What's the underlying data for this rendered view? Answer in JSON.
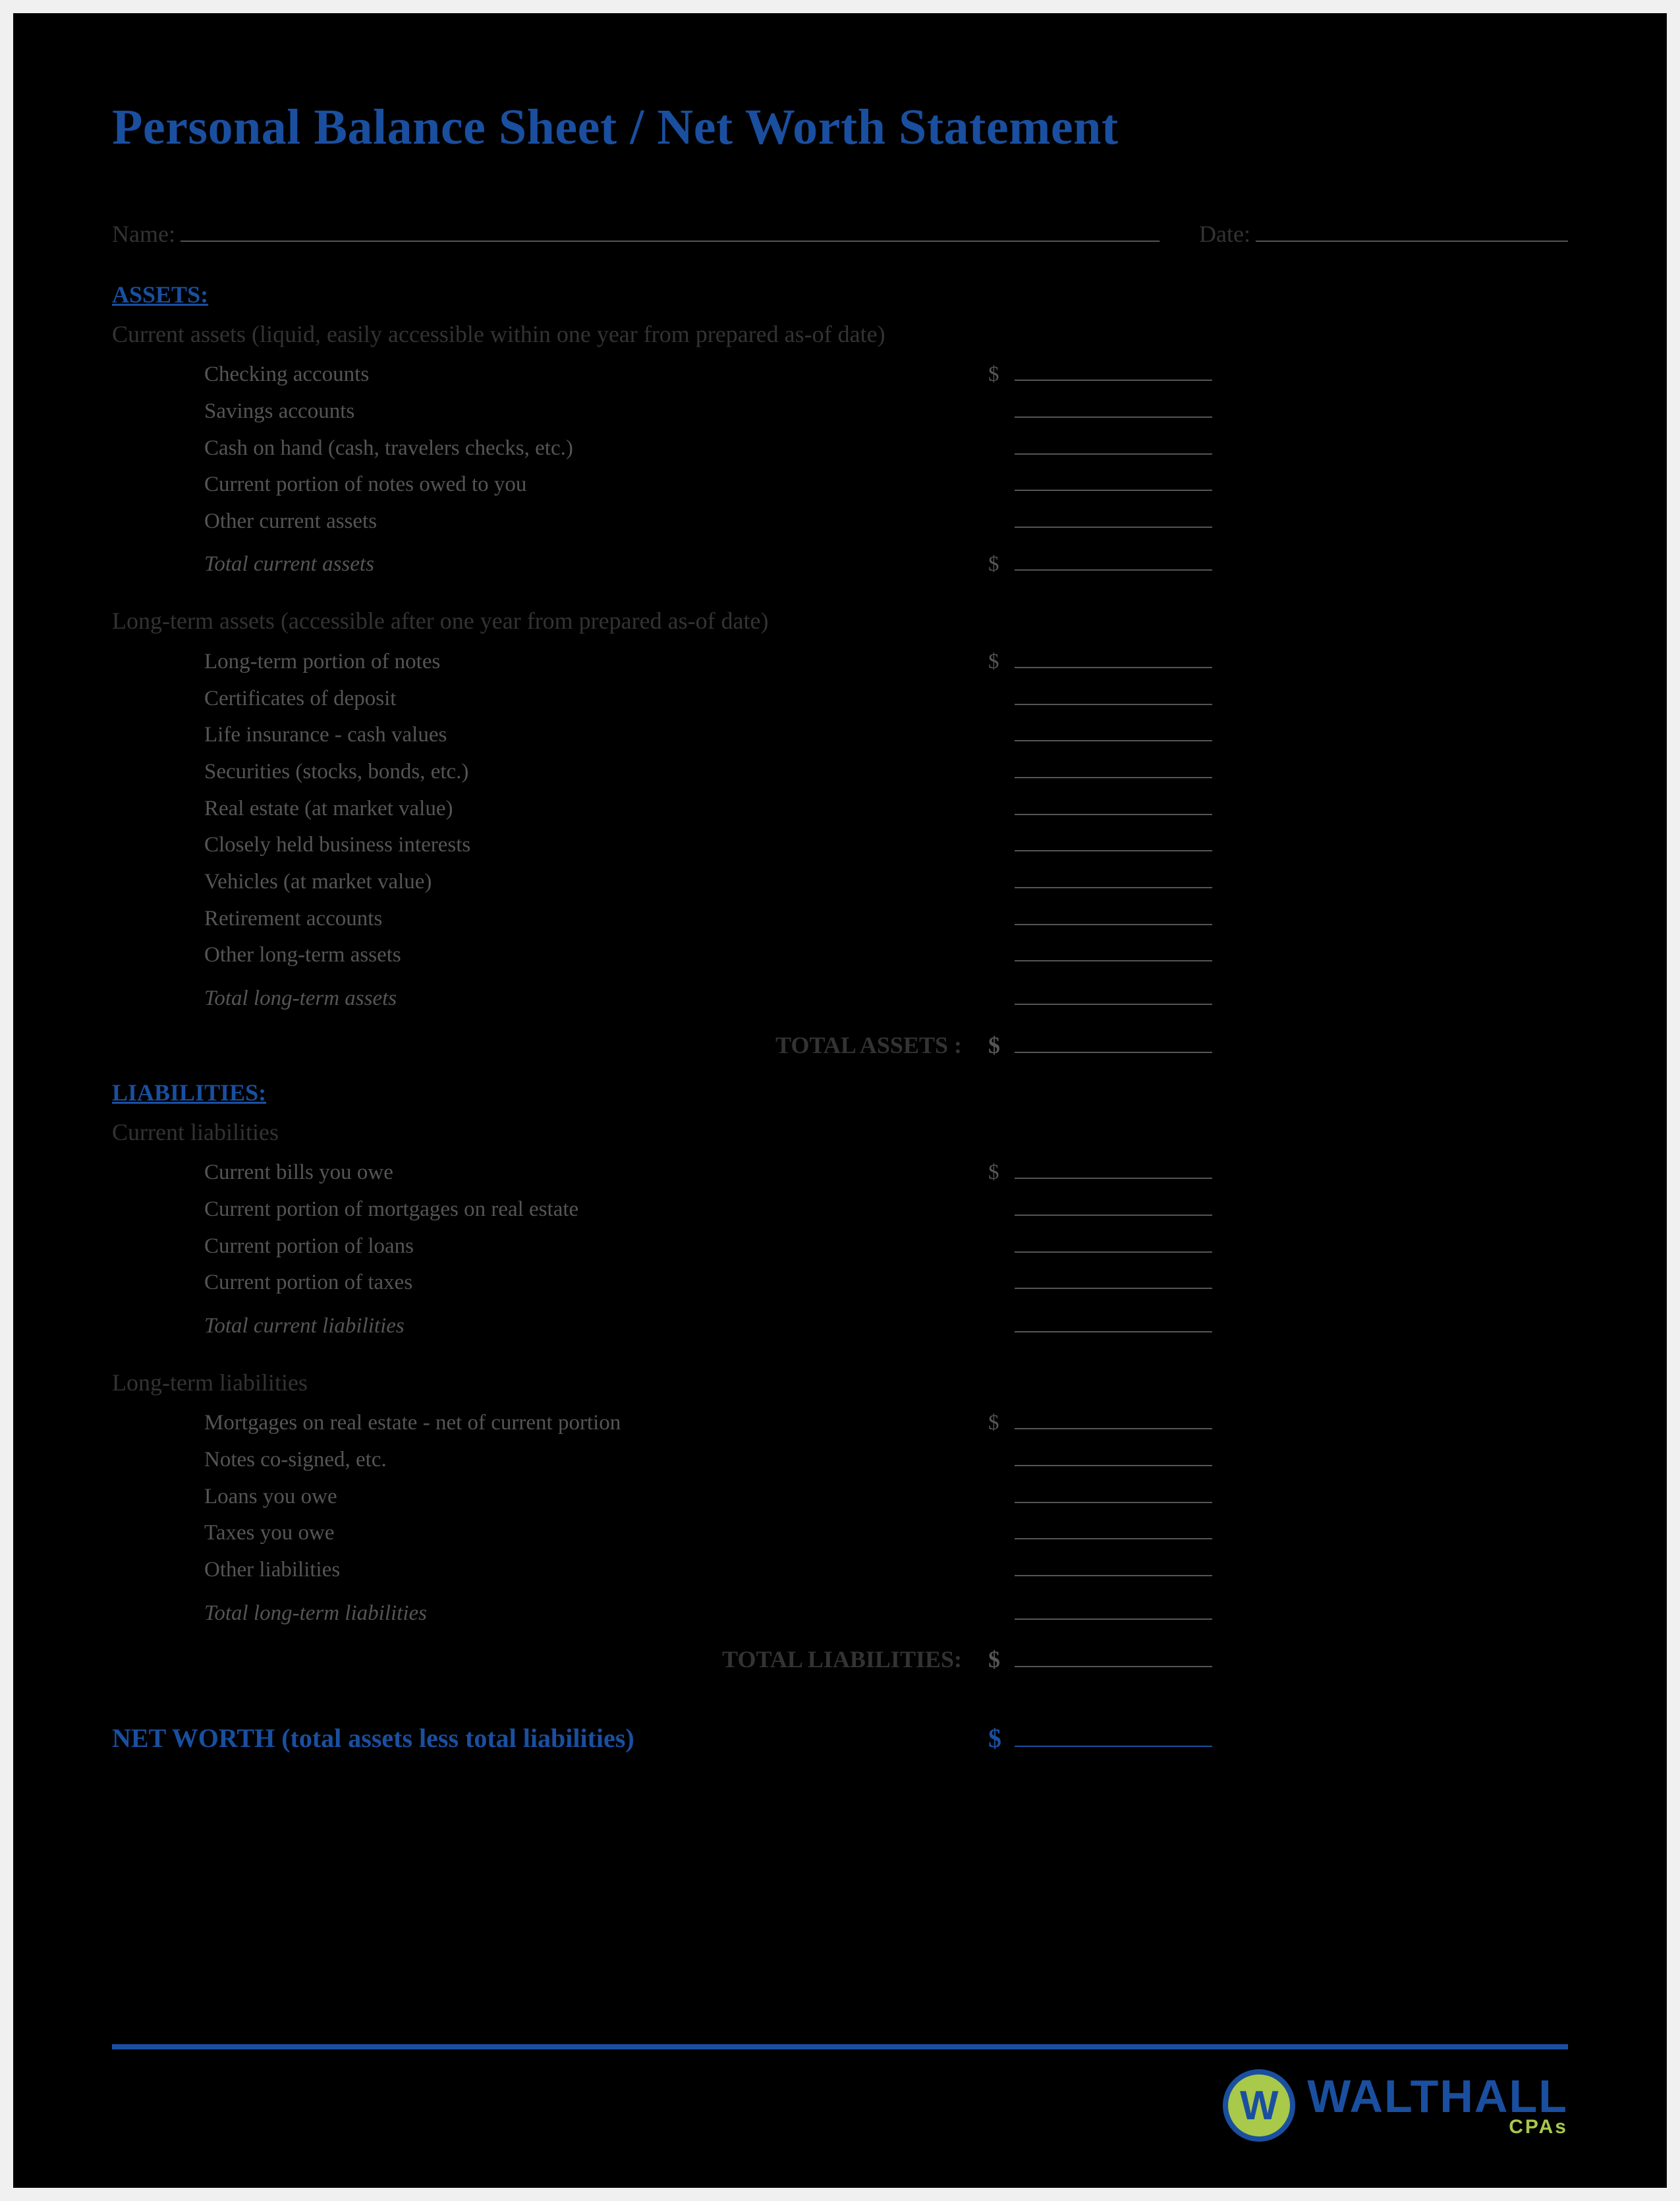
{
  "title": "Personal Balance Sheet / Net Worth Statement",
  "header": {
    "name_label": "Name:",
    "date_label": "Date:"
  },
  "assets": {
    "heading": "ASSETS:",
    "current": {
      "sub": "Current assets (liquid, easily accessible within one year from prepared as-of date)",
      "items": [
        "Checking accounts",
        "Savings accounts",
        "Cash on hand (cash, travelers checks, etc.)",
        "Current portion of notes owed to you",
        "Other current assets"
      ],
      "total": "Total current assets"
    },
    "longterm": {
      "sub": "Long-term assets (accessible after one year from prepared as-of date)",
      "items": [
        "Long-term portion of notes",
        "Certificates of deposit",
        "Life insurance - cash values",
        "Securities (stocks, bonds, etc.)",
        "Real estate (at market value)",
        "Closely held business interests",
        "Vehicles (at market value)",
        "Retirement accounts",
        "Other long-term assets"
      ],
      "total": "Total long-term assets"
    },
    "grand": "TOTAL ASSETS :"
  },
  "liabilities": {
    "heading": "LIABILITIES:",
    "current": {
      "sub": "Current liabilities",
      "items": [
        "Current bills you owe",
        "Current portion of mortgages on real estate",
        "Current portion of loans",
        "Current portion of taxes"
      ],
      "total": "Total current liabilities"
    },
    "longterm": {
      "sub": "Long-term liabilities",
      "items": [
        "Mortgages on real estate - net of current portion",
        "Notes co-signed, etc.",
        "Loans you owe",
        "Taxes you owe",
        "Other liabilities"
      ],
      "total": "Total long-term liabilities"
    },
    "grand": "TOTAL LIABILITIES:"
  },
  "networth": "NET WORTH (total assets less total liabilities)",
  "logo": {
    "mark": "W",
    "name": "WALTHALL",
    "sub": "CPAs"
  },
  "dollar": "$"
}
